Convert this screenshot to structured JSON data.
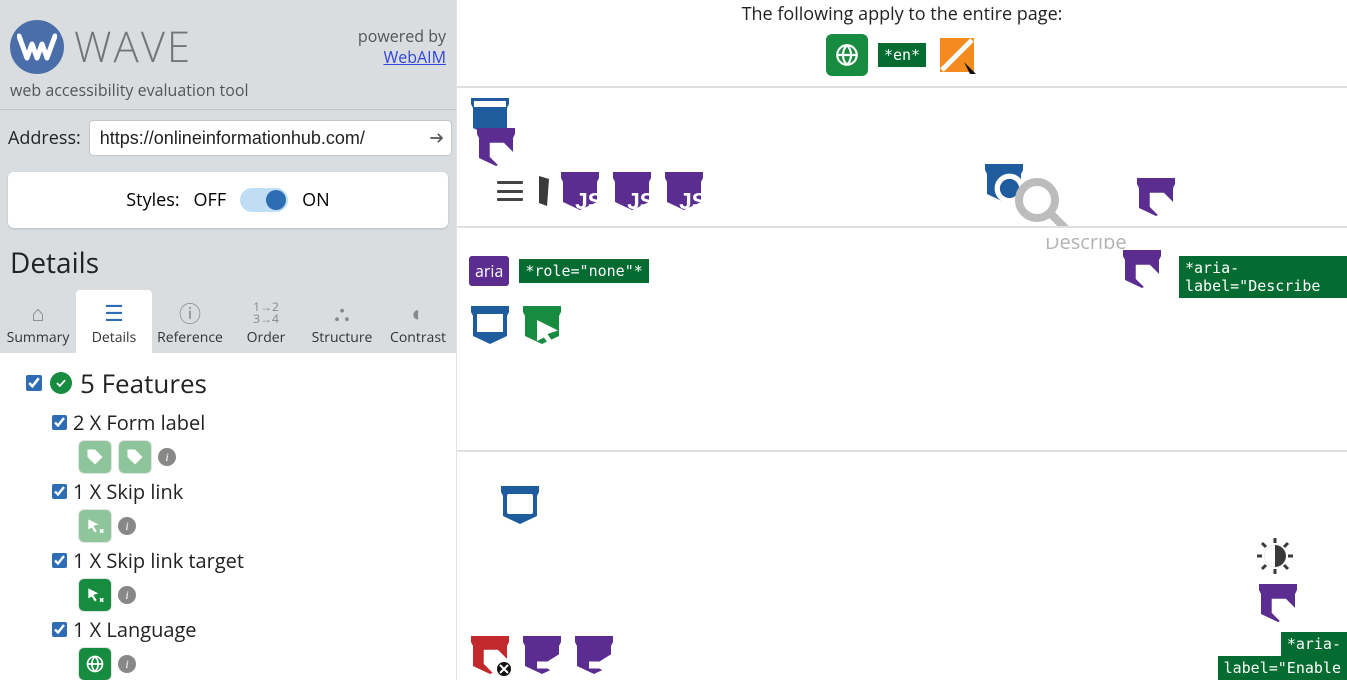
{
  "brand": {
    "name": "WAVE",
    "tagline": "web accessibility evaluation tool"
  },
  "powered": {
    "prefix": "powered by",
    "link": "WebAIM"
  },
  "address": {
    "label": "Address:",
    "value": "https://onlineinformationhub.com/"
  },
  "styles": {
    "label": "Styles:",
    "off": "OFF",
    "on": "ON"
  },
  "panel_title": "Details",
  "tabs": {
    "summary": "Summary",
    "details": "Details",
    "reference": "Reference",
    "order": "Order",
    "structure": "Structure",
    "contrast": "Contrast"
  },
  "details": {
    "category": {
      "count": 5,
      "label": "Features"
    },
    "items": [
      {
        "count": 2,
        "label": "X Form label"
      },
      {
        "count": 1,
        "label": "X Skip link"
      },
      {
        "count": 1,
        "label": "X Skip link target"
      },
      {
        "count": 1,
        "label": "X Language"
      }
    ]
  },
  "preview": {
    "entire_page_text": "The following apply to the entire page:",
    "lang_badge": "*en*",
    "aria_role_none": "*role=\"none\"*",
    "aria_describe": "*aria-label=\"Describe",
    "describe_text": "Describe",
    "aria_prefix": "*aria-",
    "aria_enable": "label=\"Enable",
    "aria_text": "aria"
  }
}
